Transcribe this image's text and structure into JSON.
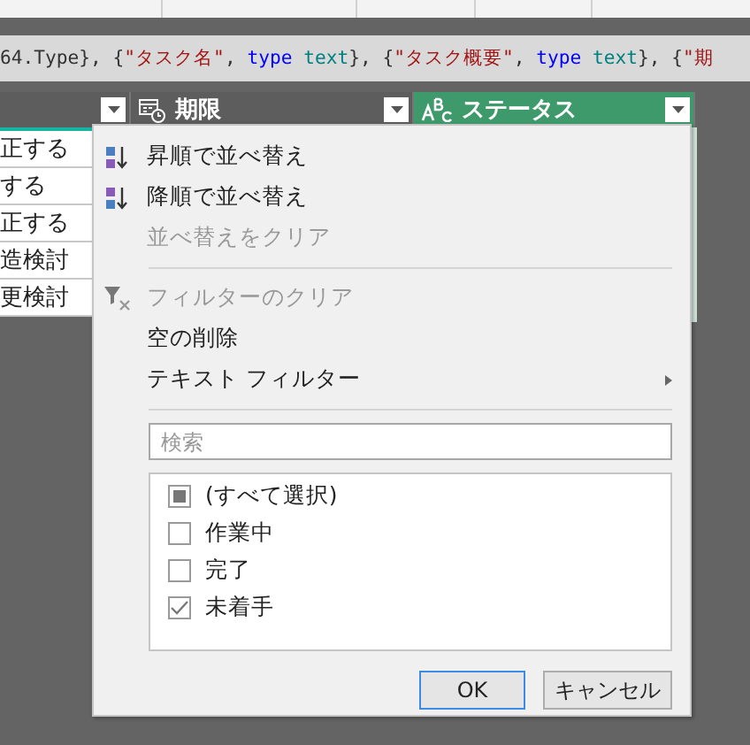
{
  "formula_bar": {
    "tokens": [
      {
        "kind": "plain",
        "text": "64.Type}, {"
      },
      {
        "kind": "string",
        "text": "\"タスク名\""
      },
      {
        "kind": "plain",
        "text": ", "
      },
      {
        "kind": "keyword",
        "text": "type"
      },
      {
        "kind": "type",
        "text": "text"
      },
      {
        "kind": "plain",
        "text": "}, {"
      },
      {
        "kind": "string",
        "text": "\"タスク概要\""
      },
      {
        "kind": "plain",
        "text": ", "
      },
      {
        "kind": "keyword",
        "text": "type"
      },
      {
        "kind": "type",
        "text": "text"
      },
      {
        "kind": "plain",
        "text": "}, {"
      },
      {
        "kind": "string",
        "text": "\"期"
      }
    ]
  },
  "columns": [
    {
      "kind": "blank",
      "selected": false
    },
    {
      "kind": "date",
      "label": "期限",
      "selected": false
    },
    {
      "kind": "text",
      "label": "ステータス",
      "selected": true
    }
  ],
  "rows": [
    "正する",
    "する",
    "正する",
    "造検討",
    "更検討"
  ],
  "menu": {
    "items": [
      {
        "kind": "sort_asc",
        "label": "昇順で並べ替え",
        "disabled": false
      },
      {
        "kind": "sort_desc",
        "label": "降順で並べ替え",
        "disabled": false
      },
      {
        "kind": "plain",
        "label": "並べ替えをクリア",
        "disabled": true
      },
      {
        "kind": "separator"
      },
      {
        "kind": "clear_filter",
        "label": "フィルターのクリア",
        "disabled": true
      },
      {
        "kind": "plain",
        "label": "空の削除",
        "disabled": false
      },
      {
        "kind": "submenu",
        "label": "テキスト フィルター",
        "disabled": false
      },
      {
        "kind": "separator"
      }
    ],
    "search": {
      "placeholder": "検索"
    },
    "values": [
      {
        "label": "(すべて選択)",
        "checked": false,
        "partial": true
      },
      {
        "label": "作業中",
        "checked": false,
        "partial": false
      },
      {
        "label": "完了",
        "checked": false,
        "partial": false
      },
      {
        "label": "未着手",
        "checked": true,
        "partial": false
      }
    ],
    "buttons": [
      {
        "label": "OK",
        "default": true
      },
      {
        "label": "キャンセル",
        "default": false
      }
    ]
  }
}
